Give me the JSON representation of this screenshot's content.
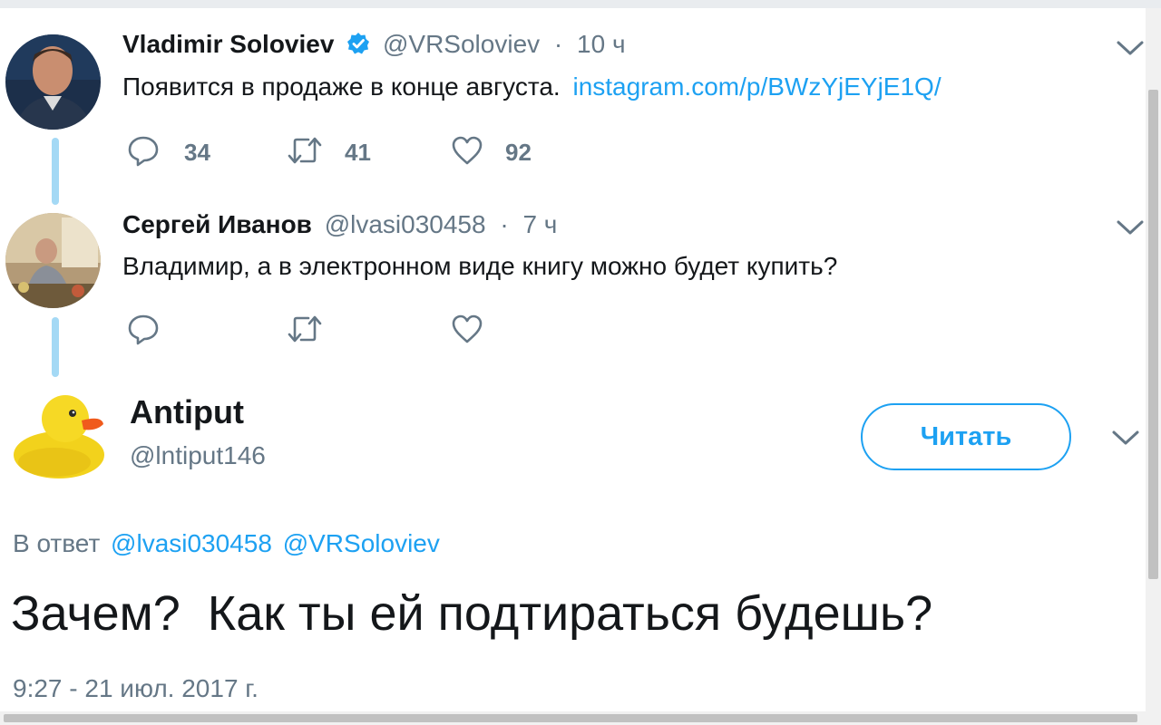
{
  "tweet1": {
    "name": "Vladimir Soloviev",
    "handle": "@VRSoloviev",
    "sep": "·",
    "time": "10 ч",
    "text": "Появится в продаже в конце августа.",
    "link": "instagram.com/p/BWzYjEYjE1Q/",
    "replies": "34",
    "retweets": "41",
    "likes": "92"
  },
  "tweet2": {
    "name": "Сергей Иванов",
    "handle": "@lvasi030458",
    "sep": "·",
    "time": "7 ч",
    "text": "Владимир, а в электронном виде книгу можно будет купить?"
  },
  "tweet3": {
    "name": "Antiput",
    "handle": "@lntiput146",
    "follow_label": "Читать",
    "reply_prefix": "В ответ",
    "reply_to_1": "@lvasi030458",
    "reply_to_2": "@VRSoloviev",
    "text": "Зачем?  Как ты ей подтираться будешь?",
    "timestamp": "9:27 - 21 июл. 2017 г."
  },
  "colors": {
    "accent": "#1da1f2",
    "muted": "#657786",
    "thread_line": "#a4d9f5",
    "text": "#14171a"
  },
  "icons": [
    "reply-icon",
    "retweet-icon",
    "like-icon",
    "chevron-down-icon",
    "verified-badge-icon"
  ]
}
